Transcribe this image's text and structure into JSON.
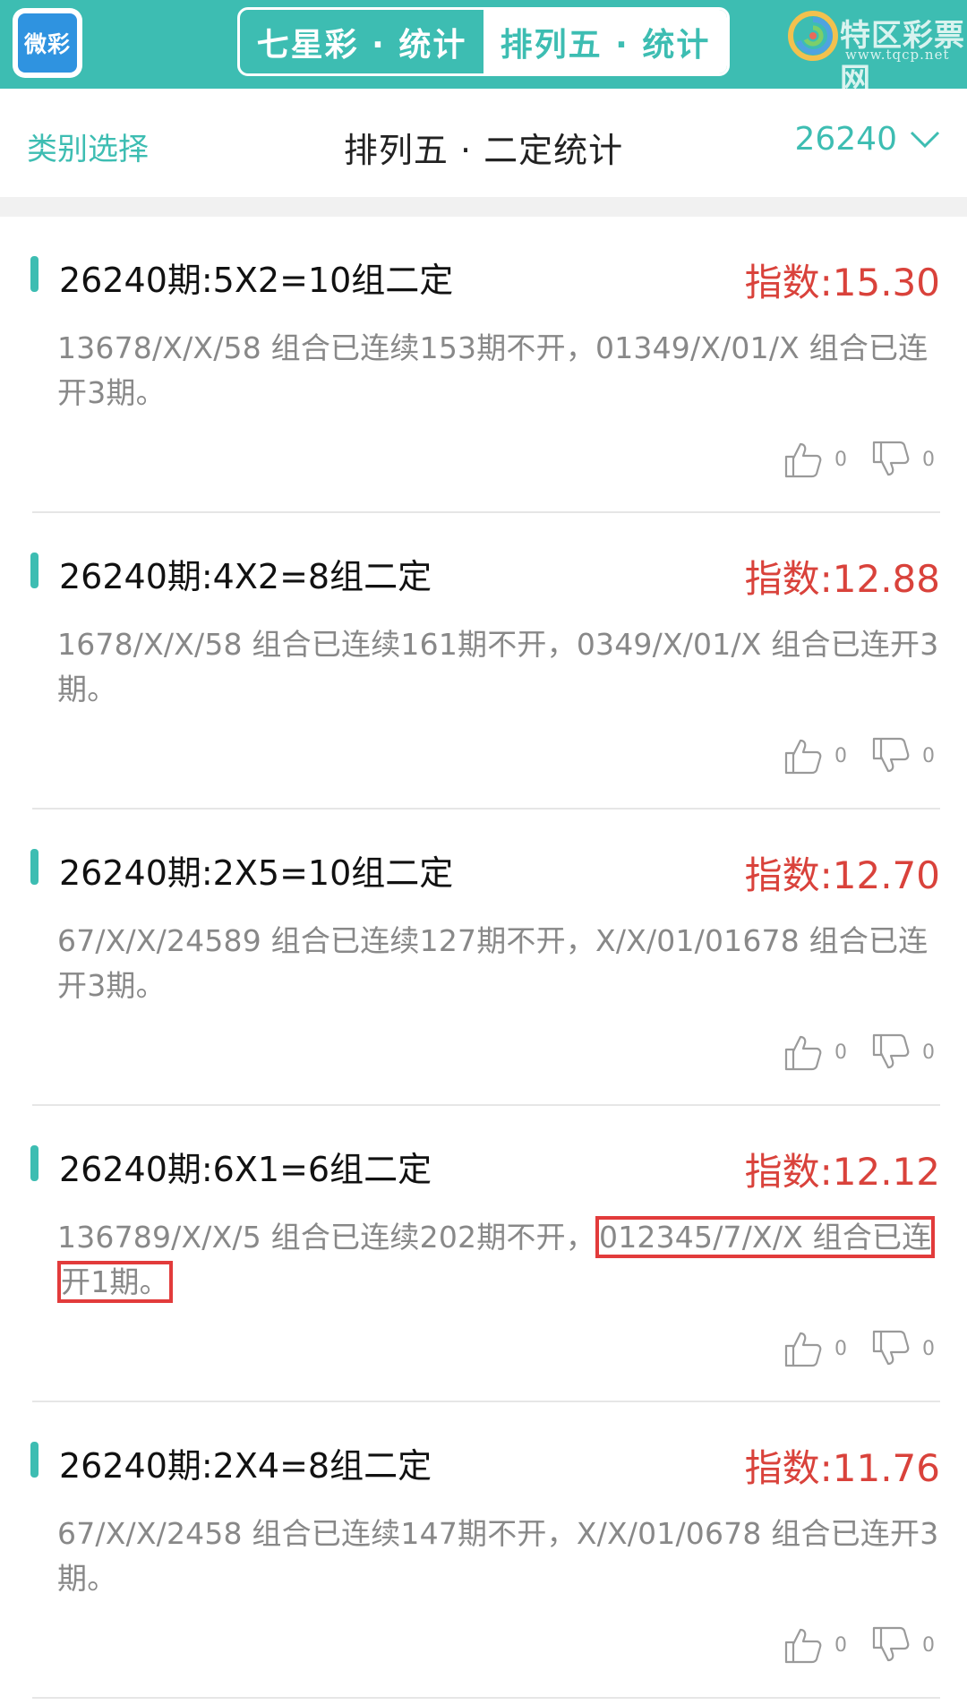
{
  "app": {
    "logo_text": "微彩",
    "tabs": [
      {
        "label": "七星彩 · 统计",
        "active": false
      },
      {
        "label": "排列五 · 统计",
        "active": true
      }
    ],
    "brand": {
      "name": "特区彩票网",
      "url": "www.tqcp.net"
    }
  },
  "subheader": {
    "category_label": "类别选择",
    "title": "排列五 · 二定统计",
    "period": "26240"
  },
  "colors": {
    "accent": "#3dbdb2",
    "index_red": "#d9423b",
    "highlight": "#e23b3b"
  },
  "cards": [
    {
      "title": "26240期:5X2=10组二定",
      "index": "指数:15.30",
      "desc": "13678/X/X/58 组合已连续153期不开，01349/X/01/X 组合已连开3期。",
      "likes": "0",
      "dislikes": "0"
    },
    {
      "title": "26240期:4X2=8组二定",
      "index": "指数:12.88",
      "desc": "1678/X/X/58 组合已连续161期不开，0349/X/01/X 组合已连开3期。",
      "likes": "0",
      "dislikes": "0"
    },
    {
      "title": "26240期:2X5=10组二定",
      "index": "指数:12.70",
      "desc": "67/X/X/24589 组合已连续127期不开，X/X/01/01678 组合已连开3期。",
      "likes": "0",
      "dislikes": "0"
    },
    {
      "title": "26240期:6X1=6组二定",
      "index": "指数:12.12",
      "desc_a": "136789/X/X/5 组合已连续202期不开，",
      "desc_b": "012345/7/X/X 组合已连",
      "desc_c": "开1期。",
      "likes": "0",
      "dislikes": "0"
    },
    {
      "title": "26240期:2X4=8组二定",
      "index": "指数:11.76",
      "desc": "67/X/X/2458 组合已连续147期不开，X/X/01/0678 组合已连开3期。",
      "likes": "0",
      "dislikes": "0"
    }
  ]
}
